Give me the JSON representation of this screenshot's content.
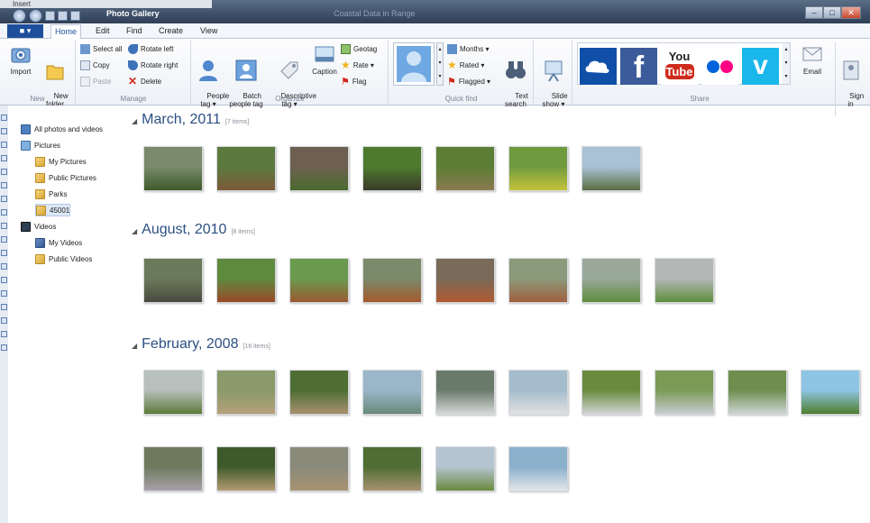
{
  "window": {
    "word_strip": "Insert",
    "title": "Photo Gallery",
    "faint_title": "Coastal Data in Range",
    "controls": [
      "–",
      "□",
      "✕"
    ]
  },
  "tabs": {
    "file": "■ ▾",
    "items": [
      "Home",
      "Edit",
      "Find",
      "Create",
      "View"
    ],
    "active": "Home"
  },
  "ribbon": {
    "new": {
      "label": "New",
      "import": "Import",
      "new_folder": "New\nfolder"
    },
    "manage": {
      "label": "Manage",
      "select_all": "Select all",
      "copy": "Copy",
      "paste": "Paste",
      "rotate_left": "Rotate left",
      "rotate_right": "Rotate right",
      "delete": "Delete"
    },
    "organize": {
      "label": "Organize",
      "people_tag": "People\ntag ▾",
      "batch_people_tag": "Batch\npeople tag",
      "descriptive_tag": "Descriptive\ntag ▾",
      "caption": "Caption",
      "geotag": "Geotag",
      "rate": "Rate ▾",
      "flag": "Flag"
    },
    "quickfind": {
      "label": "Quick find",
      "months": "Months ▾",
      "rated": "Rated ▾",
      "flagged": "Flagged ▾",
      "text_search": "Text\nsearch"
    },
    "slideshow": "Slide\nshow ▾",
    "share": {
      "label": "Share",
      "services": [
        "OneDrive",
        "Facebook",
        "YouTube",
        "Flickr",
        "Vimeo"
      ],
      "youtube_text": [
        "You",
        "Tube"
      ],
      "vimeo_text": "v",
      "facebook_text": "f",
      "email": "Email",
      "sign_in": "Sign\nin"
    }
  },
  "nav": {
    "items": [
      {
        "label": "All photos and videos",
        "level": 0,
        "icon": "gallery-icon"
      },
      {
        "label": "Pictures",
        "level": 0,
        "icon": "pictures-icon"
      },
      {
        "label": "My Pictures",
        "level": 1,
        "icon": "folder-icon"
      },
      {
        "label": "Public Pictures",
        "level": 1,
        "icon": "folder-icon"
      },
      {
        "label": "Parks",
        "level": 1,
        "icon": "folder-icon"
      },
      {
        "label": "45001",
        "level": 1,
        "icon": "folder-icon",
        "selected": true
      },
      {
        "label": "Videos",
        "level": 0,
        "icon": "videos-icon"
      },
      {
        "label": "My Videos",
        "level": 1,
        "icon": "video-folder-icon"
      },
      {
        "label": "Public Videos",
        "level": 1,
        "icon": "folder-icon"
      }
    ]
  },
  "groups": [
    {
      "title": "March, 2011",
      "count": "[7 items]",
      "thumbs": [
        [
          "#7a8a6a",
          "#3e5a2c"
        ],
        [
          "#5b7a3e",
          "#7c5a3a"
        ],
        [
          "#6e6050",
          "#4a6a2e"
        ],
        [
          "#4e7a2e",
          "#3a3a2a"
        ],
        [
          "#5c7e34",
          "#8a7a50"
        ],
        [
          "#6f9a3e",
          "#c5c23a"
        ],
        [
          "#a9c2d6",
          "#5a6e42"
        ]
      ]
    },
    {
      "title": "August, 2010",
      "count": "[8 items]",
      "thumbs": [
        [
          "#6a7a5a",
          "#4a4a40"
        ],
        [
          "#5e8a3e",
          "#9a4a2a"
        ],
        [
          "#6a9a4e",
          "#9a5a32"
        ],
        [
          "#7a8a6a",
          "#a55a2e"
        ],
        [
          "#7a6a5a",
          "#b05a30"
        ],
        [
          "#8a9a7a",
          "#a06040"
        ],
        [
          "#9aa89a",
          "#5e8e3e"
        ],
        [
          "#b5b7b6",
          "#5e8e3e"
        ]
      ]
    },
    {
      "title": "February, 2008",
      "count": "[16 items]",
      "thumbs": [
        [
          "#b7c0bc",
          "#5e7a3a"
        ],
        [
          "#8a9a6a",
          "#b5a07a"
        ],
        [
          "#4e6e34",
          "#a89070"
        ],
        [
          "#9ab6c8",
          "#6a8a7a"
        ],
        [
          "#6a7a6a",
          "#d5d8d8"
        ],
        [
          "#a5bccc",
          "#e0e0e0"
        ],
        [
          "#6a8a3e",
          "#d0d4d4"
        ],
        [
          "#7a9a56",
          "#c7ccd0"
        ],
        [
          "#6e8e4e",
          "#ced4d4"
        ],
        [
          "#8ec5e4",
          "#4e7e2e"
        ],
        [
          "#6e7a5e",
          "#a8a0a8"
        ],
        [
          "#3e5a2a",
          "#b49a72"
        ],
        [
          "#8a8a7a",
          "#a89272"
        ],
        [
          "#4e6e34",
          "#a89070"
        ],
        [
          "#b5c4d0",
          "#6a8a3e"
        ],
        [
          "#8ab0cc",
          "#e4e6e8"
        ]
      ]
    }
  ]
}
